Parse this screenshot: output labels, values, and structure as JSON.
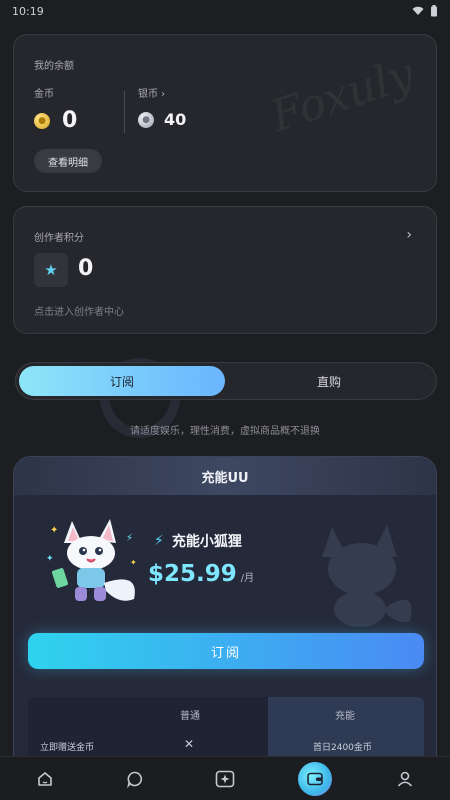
{
  "status": {
    "time": "10:19"
  },
  "balance": {
    "title": "我的余额",
    "gold_label": "金币",
    "gold_value": "0",
    "silver_label": "银币 ›",
    "silver_value": "40",
    "detail_button": "查看明细"
  },
  "creator": {
    "title": "创作者积分",
    "value": "0",
    "hint": "点击进入创作者中心",
    "chevron": "›"
  },
  "tabs": [
    {
      "label": "订阅",
      "active": true
    },
    {
      "label": "直购",
      "active": false
    }
  ],
  "notice": "请适度娱乐，理性消费，虚拟商品概不退换",
  "plan": {
    "header": "充能UU",
    "name": "充能小狐狸",
    "price": "$25.99",
    "unit": "/月",
    "subscribe_button": "订阅",
    "compare": {
      "headers": [
        "普通",
        "充能"
      ],
      "rows": [
        {
          "label": "立即赠送金币",
          "normal": "✕",
          "premium": "首日2400金币"
        }
      ]
    }
  },
  "nav": [
    {
      "icon": "home-icon"
    },
    {
      "icon": "chat-icon"
    },
    {
      "icon": "create-icon"
    },
    {
      "icon": "wallet-icon",
      "active": true
    },
    {
      "icon": "profile-icon"
    }
  ],
  "colors": {
    "accent": "#4fd2f3",
    "price": "#7ee6ff",
    "background": "#1d1e22"
  }
}
